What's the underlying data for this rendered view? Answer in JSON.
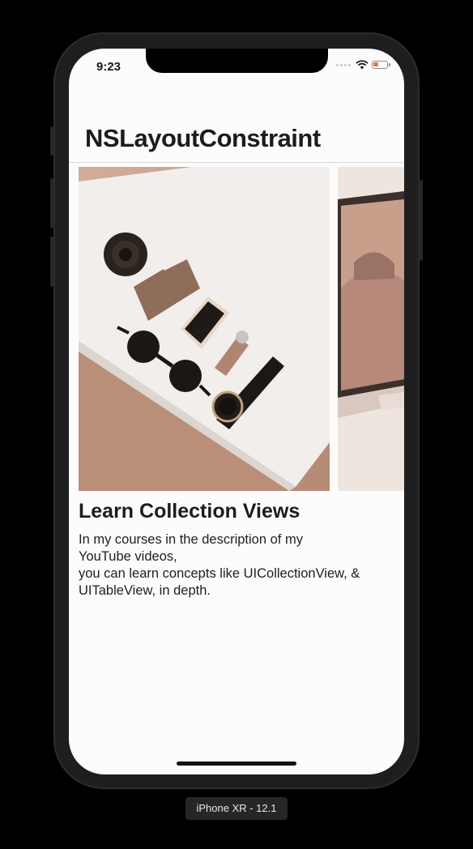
{
  "status_bar": {
    "time": "9:23"
  },
  "nav": {
    "title": "NSLayoutConstraint"
  },
  "carousel": {
    "items": [
      {
        "image": "desk-flatlay-photo",
        "visible": "full"
      },
      {
        "image": "laptop-desert-wallpaper-photo",
        "visible": "partial"
      }
    ]
  },
  "content": {
    "headline": "Learn Collection Views",
    "body_lines": [
      "In my courses in the description of my",
      "YouTube videos,",
      "you can learn concepts like UICollectionView, &",
      "UITableView, in depth."
    ]
  },
  "simulator": {
    "device_label": "iPhone XR - 12.1"
  },
  "colors": {
    "photo_tone": "#c09a84",
    "background": "#fdfcfc",
    "text": "#1c1c1c"
  }
}
